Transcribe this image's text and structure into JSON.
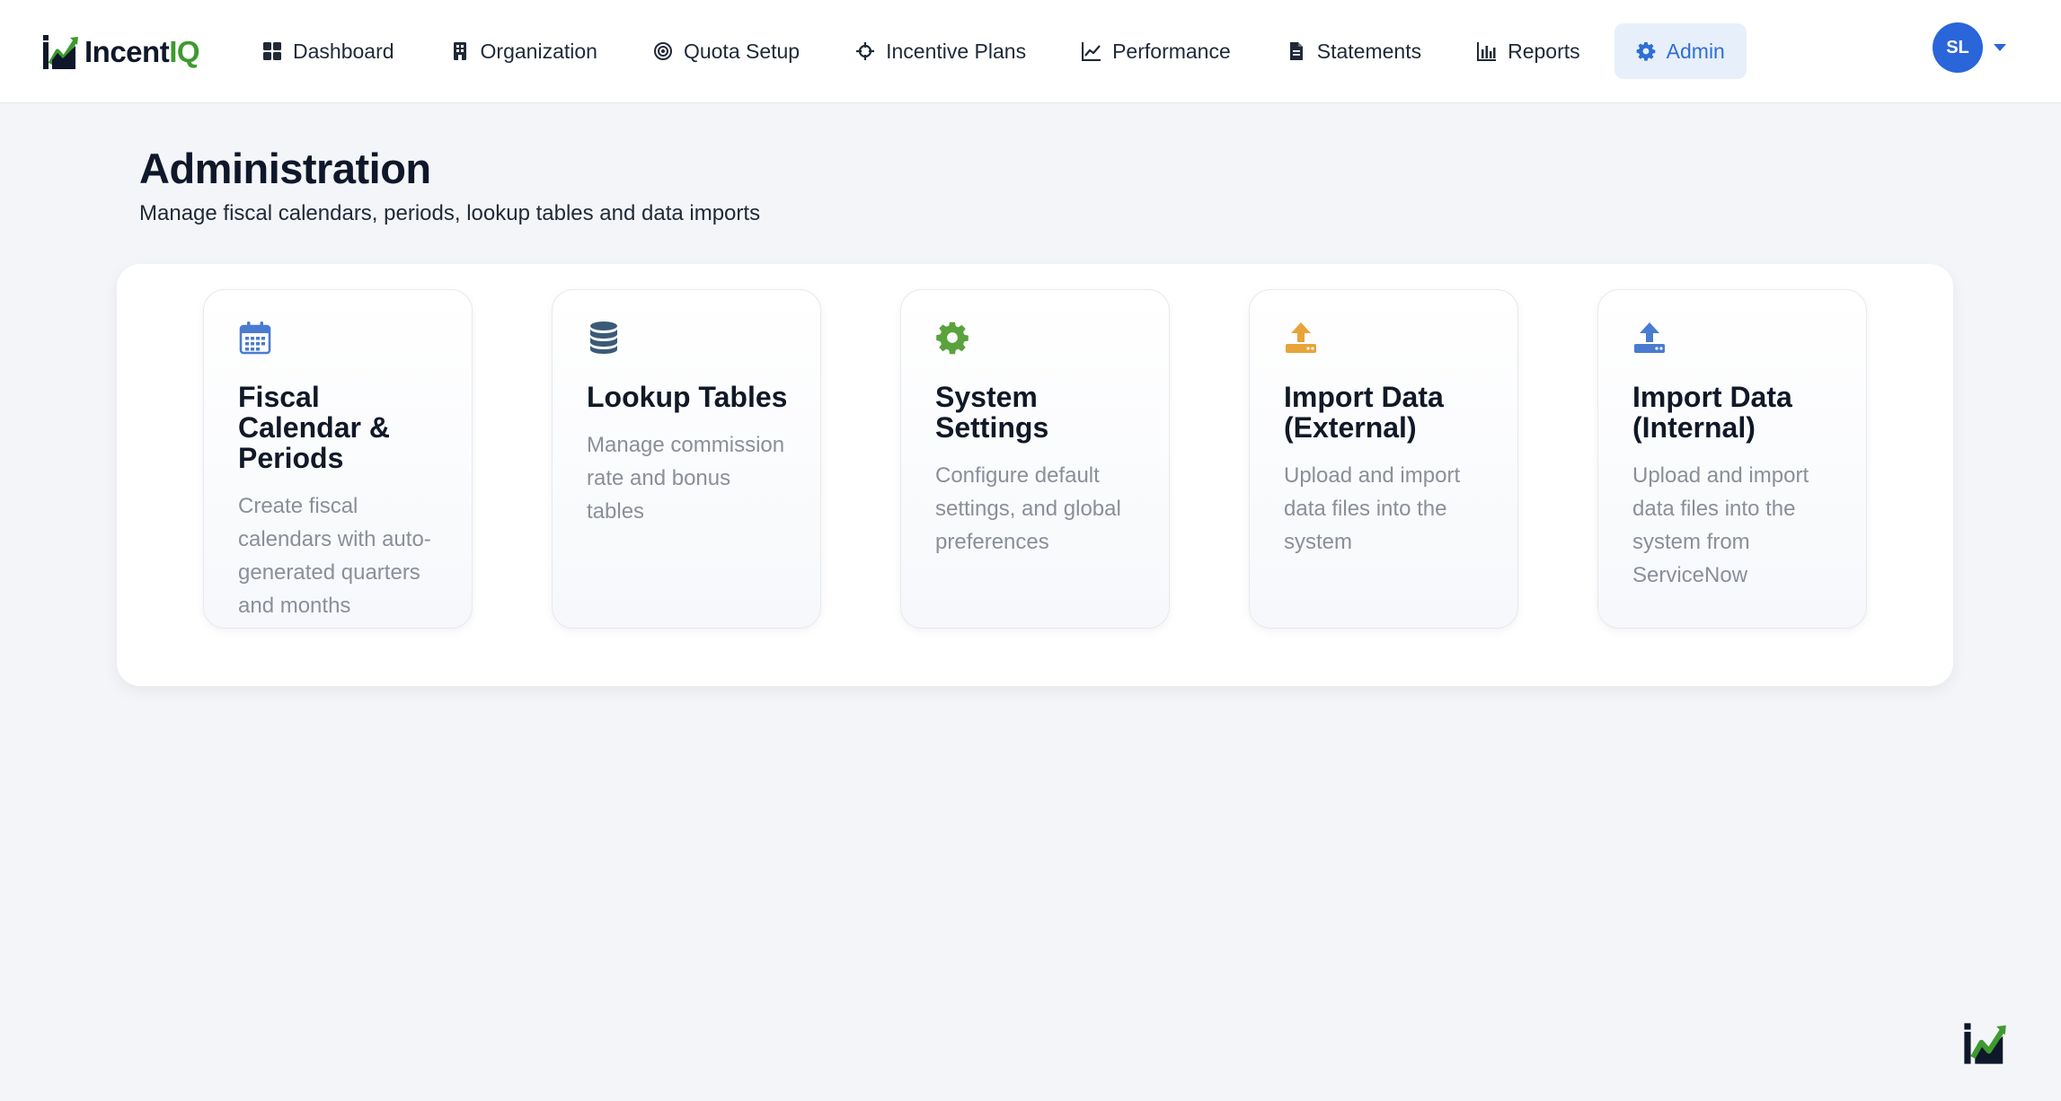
{
  "brand": {
    "name_main": "Incent",
    "name_accent": "IQ",
    "colors": {
      "dark": "#0f172a",
      "accent": "#3e9a2f"
    }
  },
  "nav": {
    "items": [
      {
        "label": "Dashboard",
        "icon": "grid-icon"
      },
      {
        "label": "Organization",
        "icon": "building-icon"
      },
      {
        "label": "Quota Setup",
        "icon": "target-icon"
      },
      {
        "label": "Incentive Plans",
        "icon": "crosshair-icon"
      },
      {
        "label": "Performance",
        "icon": "line-chart-icon"
      },
      {
        "label": "Statements",
        "icon": "document-icon"
      },
      {
        "label": "Reports",
        "icon": "bar-chart-icon"
      },
      {
        "label": "Admin",
        "icon": "gear-icon",
        "active": true
      }
    ],
    "active_color": "#2f6fd3",
    "active_bg": "#e7effb"
  },
  "user": {
    "initials": "SL",
    "avatar_color": "#2a66d9"
  },
  "page": {
    "title": "Administration",
    "subtitle": "Manage fiscal calendars, periods, lookup tables and data imports"
  },
  "cards": [
    {
      "title": "Fiscal Calendar & Periods",
      "description": "Create fiscal calendars with auto-generated quarters and months",
      "icon": "calendar-icon",
      "icon_color": "#4a7bd0"
    },
    {
      "title": "Lookup Tables",
      "description": "Manage commission rate and bonus tables",
      "icon": "database-icon",
      "icon_color": "#3b5a78"
    },
    {
      "title": "System Settings",
      "description": "Configure default settings, and global preferences",
      "icon": "gear-icon",
      "icon_color": "#5aa23c"
    },
    {
      "title": "Import Data (External)",
      "description": "Upload and import data files into the system",
      "icon": "upload-icon",
      "icon_color": "#e8a33a"
    },
    {
      "title": "Import Data (Internal)",
      "description": "Upload and import data files into the system from ServiceNow",
      "icon": "upload-icon",
      "icon_color": "#4a7bd0"
    }
  ]
}
